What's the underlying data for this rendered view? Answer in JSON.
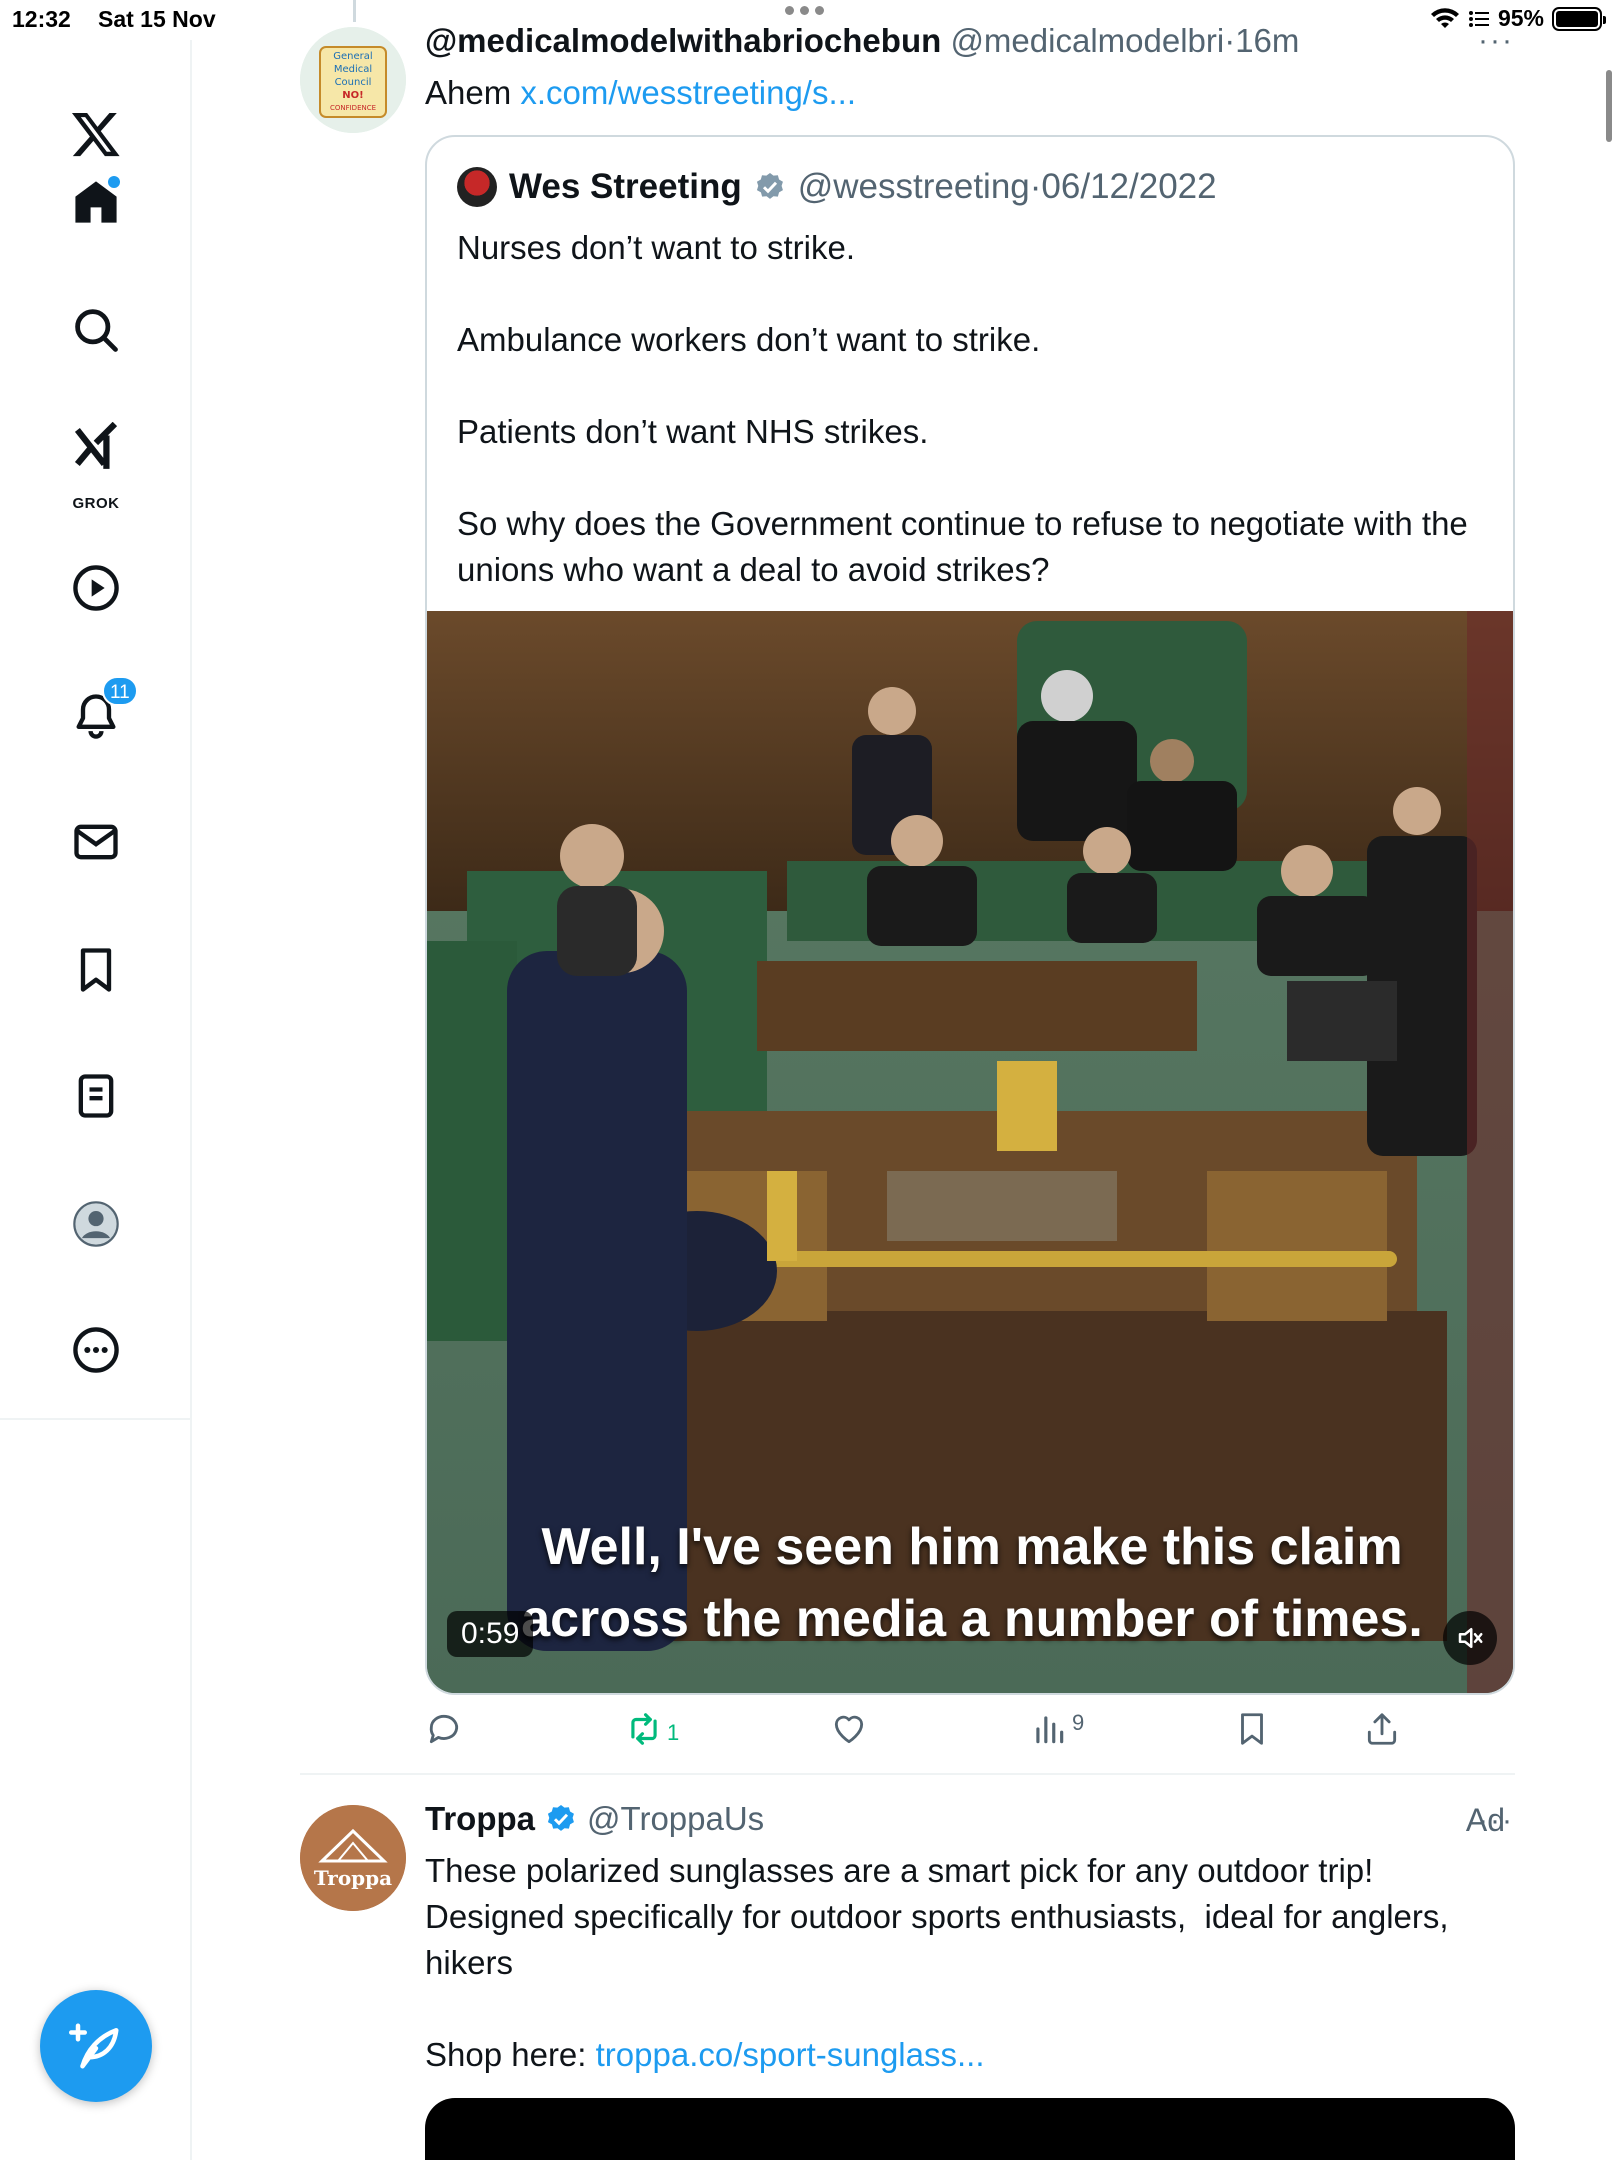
{
  "status_bar": {
    "time": "12:32",
    "date": "Sat 15 Nov",
    "battery": "95%"
  },
  "sidebar": {
    "grok_label": "GROK",
    "notifications_badge": "11",
    "accent_color": "#1d9bf0"
  },
  "tweet": {
    "display_name": "@medicalmodelwithabriochebun",
    "handle": "@medicalmodelbri",
    "separator": "·",
    "time": "16m",
    "text_prefix": "Ahem ",
    "link_text": "x.com/wesstreeting/s...",
    "avatar_lines": [
      "General",
      "Medical",
      "Council",
      "NO!",
      "CONFIDENCE"
    ],
    "quoted": {
      "display_name": "Wes Streeting",
      "handle": "@wesstreeting",
      "separator": "·",
      "date": "06/12/2022",
      "text": "Nurses don’t want to strike.\n\nAmbulance workers don’t want to strike.\n\nPatients don’t want NHS strikes.\n\nSo why does the Government continue to refuse to negotiate with the unions who want a deal to avoid strikes?",
      "video": {
        "caption_line1": "Well, I've seen him make this claim",
        "caption_line2": "across the media a number of times.",
        "duration": "0:59"
      }
    },
    "actions": {
      "reposts": "1",
      "views": "9"
    }
  },
  "ad": {
    "display_name": "Troppa",
    "handle": "@TroppaUs",
    "label": "Ad",
    "avatar_text": "Troppa",
    "text": "These polarized sunglasses are a smart pick for any outdoor trip!\nDesigned specifically for outdoor sports enthusiasts,  ideal for anglers,\nhikers",
    "shop_prefix": "Shop here: ",
    "shop_link": "troppa.co/sport-sunglass..."
  }
}
